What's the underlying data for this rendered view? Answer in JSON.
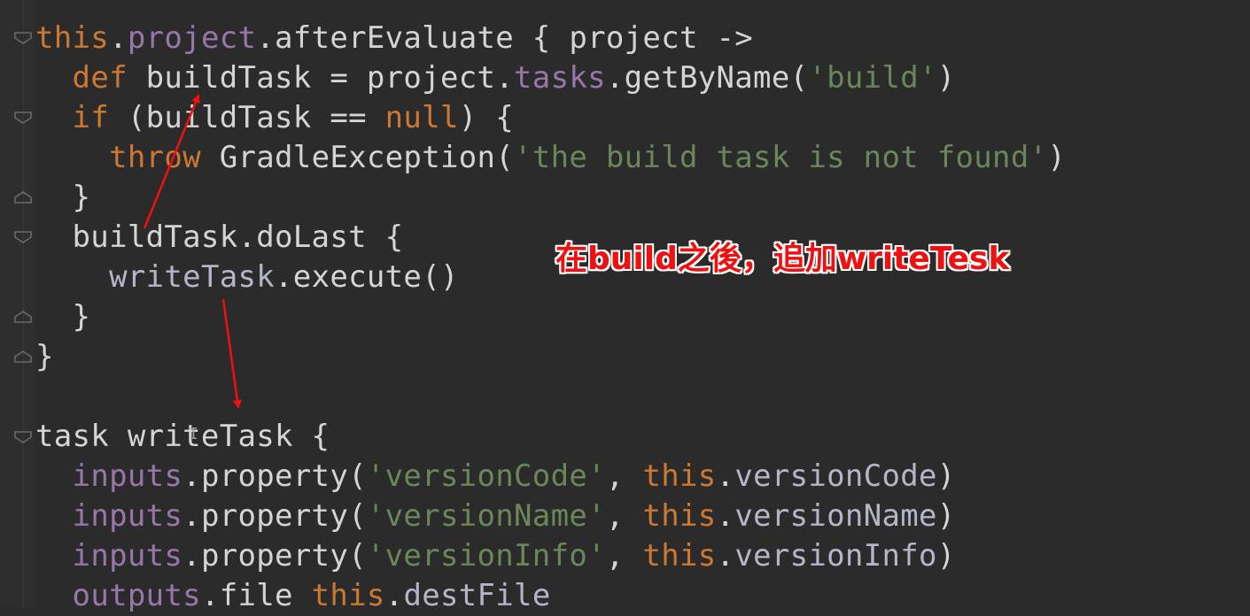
{
  "editor": {
    "lines": [
      [
        {
          "t": "this",
          "c": "kw"
        },
        {
          "t": ".",
          "c": "pln"
        },
        {
          "t": "project",
          "c": "fld"
        },
        {
          "t": ".afterEvaluate { project ->",
          "c": "pln"
        }
      ],
      [
        {
          "t": "  ",
          "c": "pln"
        },
        {
          "t": "def",
          "c": "kw"
        },
        {
          "t": " buildTask = project.",
          "c": "pln"
        },
        {
          "t": "tasks",
          "c": "fld"
        },
        {
          "t": ".getByName(",
          "c": "pln"
        },
        {
          "t": "'build'",
          "c": "str"
        },
        {
          "t": ")",
          "c": "pln"
        }
      ],
      [
        {
          "t": "  ",
          "c": "pln"
        },
        {
          "t": "if",
          "c": "kw"
        },
        {
          "t": " (buildTask == ",
          "c": "pln"
        },
        {
          "t": "null",
          "c": "kw"
        },
        {
          "t": ") {",
          "c": "pln"
        }
      ],
      [
        {
          "t": "    ",
          "c": "pln"
        },
        {
          "t": "throw",
          "c": "kw"
        },
        {
          "t": " GradleException(",
          "c": "pln"
        },
        {
          "t": "'the build task is not found'",
          "c": "str"
        },
        {
          "t": ")",
          "c": "pln"
        }
      ],
      [
        {
          "t": "  }",
          "c": "pln"
        }
      ],
      [
        {
          "t": "  buildTask.doLast {",
          "c": "pln"
        }
      ],
      [
        {
          "t": "    ",
          "c": "pln"
        },
        {
          "t": "writeTask",
          "c": "lvar"
        },
        {
          "t": ".execute()",
          "c": "pln"
        }
      ],
      [
        {
          "t": "  }",
          "c": "pln"
        }
      ],
      [
        {
          "t": "}",
          "c": "pln"
        }
      ],
      [],
      [
        {
          "t": "task writeTask {",
          "c": "pln"
        }
      ],
      [
        {
          "t": "  ",
          "c": "pln"
        },
        {
          "t": "inputs",
          "c": "fld"
        },
        {
          "t": ".property(",
          "c": "pln"
        },
        {
          "t": "'versionCode'",
          "c": "str"
        },
        {
          "t": ", ",
          "c": "pln"
        },
        {
          "t": "this",
          "c": "kw"
        },
        {
          "t": ".",
          "c": "pln"
        },
        {
          "t": "versionCode",
          "c": "lvar"
        },
        {
          "t": ")",
          "c": "pln"
        }
      ],
      [
        {
          "t": "  ",
          "c": "pln"
        },
        {
          "t": "inputs",
          "c": "fld"
        },
        {
          "t": ".property(",
          "c": "pln"
        },
        {
          "t": "'versionName'",
          "c": "str"
        },
        {
          "t": ", ",
          "c": "pln"
        },
        {
          "t": "this",
          "c": "kw"
        },
        {
          "t": ".",
          "c": "pln"
        },
        {
          "t": "versionName",
          "c": "lvar"
        },
        {
          "t": ")",
          "c": "pln"
        }
      ],
      [
        {
          "t": "  ",
          "c": "pln"
        },
        {
          "t": "inputs",
          "c": "fld"
        },
        {
          "t": ".property(",
          "c": "pln"
        },
        {
          "t": "'versionInfo'",
          "c": "str"
        },
        {
          "t": ", ",
          "c": "pln"
        },
        {
          "t": "this",
          "c": "kw"
        },
        {
          "t": ".",
          "c": "pln"
        },
        {
          "t": "versionInfo",
          "c": "lvar"
        },
        {
          "t": ")",
          "c": "pln"
        }
      ],
      [
        {
          "t": "  ",
          "c": "pln"
        },
        {
          "t": "outputs",
          "c": "fld"
        },
        {
          "t": ".file ",
          "c": "pln"
        },
        {
          "t": "this",
          "c": "kw"
        },
        {
          "t": ".",
          "c": "pln"
        },
        {
          "t": "destFile",
          "c": "lvar"
        }
      ]
    ]
  },
  "annotation": {
    "text": "在build之後，追加writeTesk",
    "color": "#ee1111"
  },
  "colors": {
    "background": "#2b2b2b",
    "keyword": "#cc7832",
    "field": "#9876aa",
    "string": "#6a8759",
    "plain": "#d4d4d4",
    "arrow": "#ee1111"
  }
}
